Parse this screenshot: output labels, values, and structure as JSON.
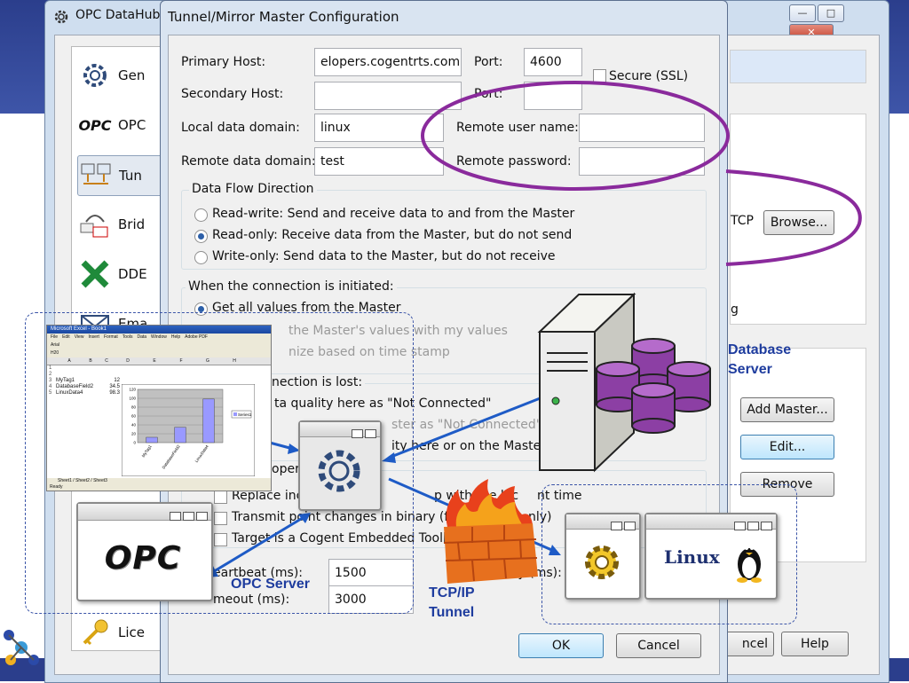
{
  "main_window": {
    "title": "OPC DataHub",
    "nav": [
      "Gen",
      "OPC",
      "Tun",
      "Brid",
      "DDE",
      "Ema",
      "Lice"
    ],
    "right_fragments": {
      "tcp": "TCP",
      "log": "g",
      "cancel": "ncel"
    },
    "buttons": {
      "browse": "Browse...",
      "add_master": "Add Master...",
      "edit": "Edit...",
      "remove": "Remove",
      "help": "Help"
    }
  },
  "dialog": {
    "title": "Tunnel/Mirror Master Configuration",
    "primary_host_label": "Primary Host:",
    "primary_host_value": "elopers.cogentrts.com",
    "port_label": "Port:",
    "port_value": "4600",
    "secure_label": "Secure (SSL)",
    "secondary_host_label": "Secondary Host:",
    "secondary_port_label": "Port:",
    "local_domain_label": "Local data domain:",
    "local_domain_value": "linux",
    "remote_user_label": "Remote user name:",
    "remote_domain_label": "Remote data domain:",
    "remote_domain_value": "test",
    "remote_password_label": "Remote password:",
    "data_flow": {
      "title": "Data Flow Direction",
      "options": [
        "Read-write: Send and receive data to and from the Master",
        "Read-only: Receive data from the Master, but do not send",
        "Write-only: Send data to the Master, but do not receive"
      ],
      "selected": 1
    },
    "on_init": {
      "title": "When the connection is initiated:",
      "options": [
        "Get all values from the Master",
        "the Master's values with my values",
        "nize based on time stamp"
      ]
    },
    "on_lost": {
      "title": "nection is lost:",
      "lines": [
        "ta quality here as \"Not Connected\"",
        "ster as \"Not Connected\"",
        "ity here or on the Master"
      ]
    },
    "options_title": "oper",
    "checkboxes": [
      "Replace incon",
      "p with the loc",
      "nt time",
      "Transmit point changes in binary (fast",
      "nly)",
      "Target is a Cogent Embedded Toolkit"
    ],
    "heartbeat_label": "eartbeat (ms):",
    "heartbeat_value": "1500",
    "retry_label": "Retry Delay (ms):",
    "timeout_label": "meout (ms):",
    "timeout_value": "3000",
    "ok": "OK",
    "cancel": "Cancel"
  },
  "callouts": {
    "database": "Database Server",
    "opc": "OPC Server",
    "tcp": "TCP/IP Tunnel"
  },
  "excel": {
    "title": "Microsoft Excel - Book1",
    "menu": [
      "File",
      "Edit",
      "View",
      "Insert",
      "Format",
      "Tools",
      "Data",
      "Window",
      "Help",
      "Adobe PDF"
    ],
    "font": "Arial",
    "cell_ref": "H20",
    "columns": [
      "A",
      "B",
      "C",
      "D",
      "E",
      "F",
      "G",
      "H"
    ],
    "rows": [
      {
        "n": "1",
        "a": "",
        "b": ""
      },
      {
        "n": "2",
        "a": "",
        "b": ""
      },
      {
        "n": "3",
        "a": "MyTag1",
        "b": "12"
      },
      {
        "n": "4",
        "a": "DatabaseField2",
        "b": "34.5"
      },
      {
        "n": "5",
        "a": "LinuxData4",
        "b": "98.3"
      }
    ],
    "sheets": [
      "Sheet1",
      "Sheet2",
      "Sheet3"
    ],
    "status": "Ready",
    "chart_data": {
      "type": "bar",
      "categories": [
        "MyTag1",
        "DatabaseField2",
        "LinuxData4"
      ],
      "series": [
        {
          "name": "Series1",
          "values": [
            12,
            34.5,
            98.3
          ]
        }
      ],
      "ylim": [
        0,
        120
      ],
      "yticks": [
        0,
        20,
        40,
        60,
        80,
        100,
        120
      ]
    }
  },
  "linux_label": "Linux",
  "opc_logo": "OPC",
  "colors": {
    "accent": "#1e3c9e",
    "ellipse": "#8a2a9c",
    "arrow": "#1e5bc6",
    "cylinder": "#8c3fa4"
  }
}
